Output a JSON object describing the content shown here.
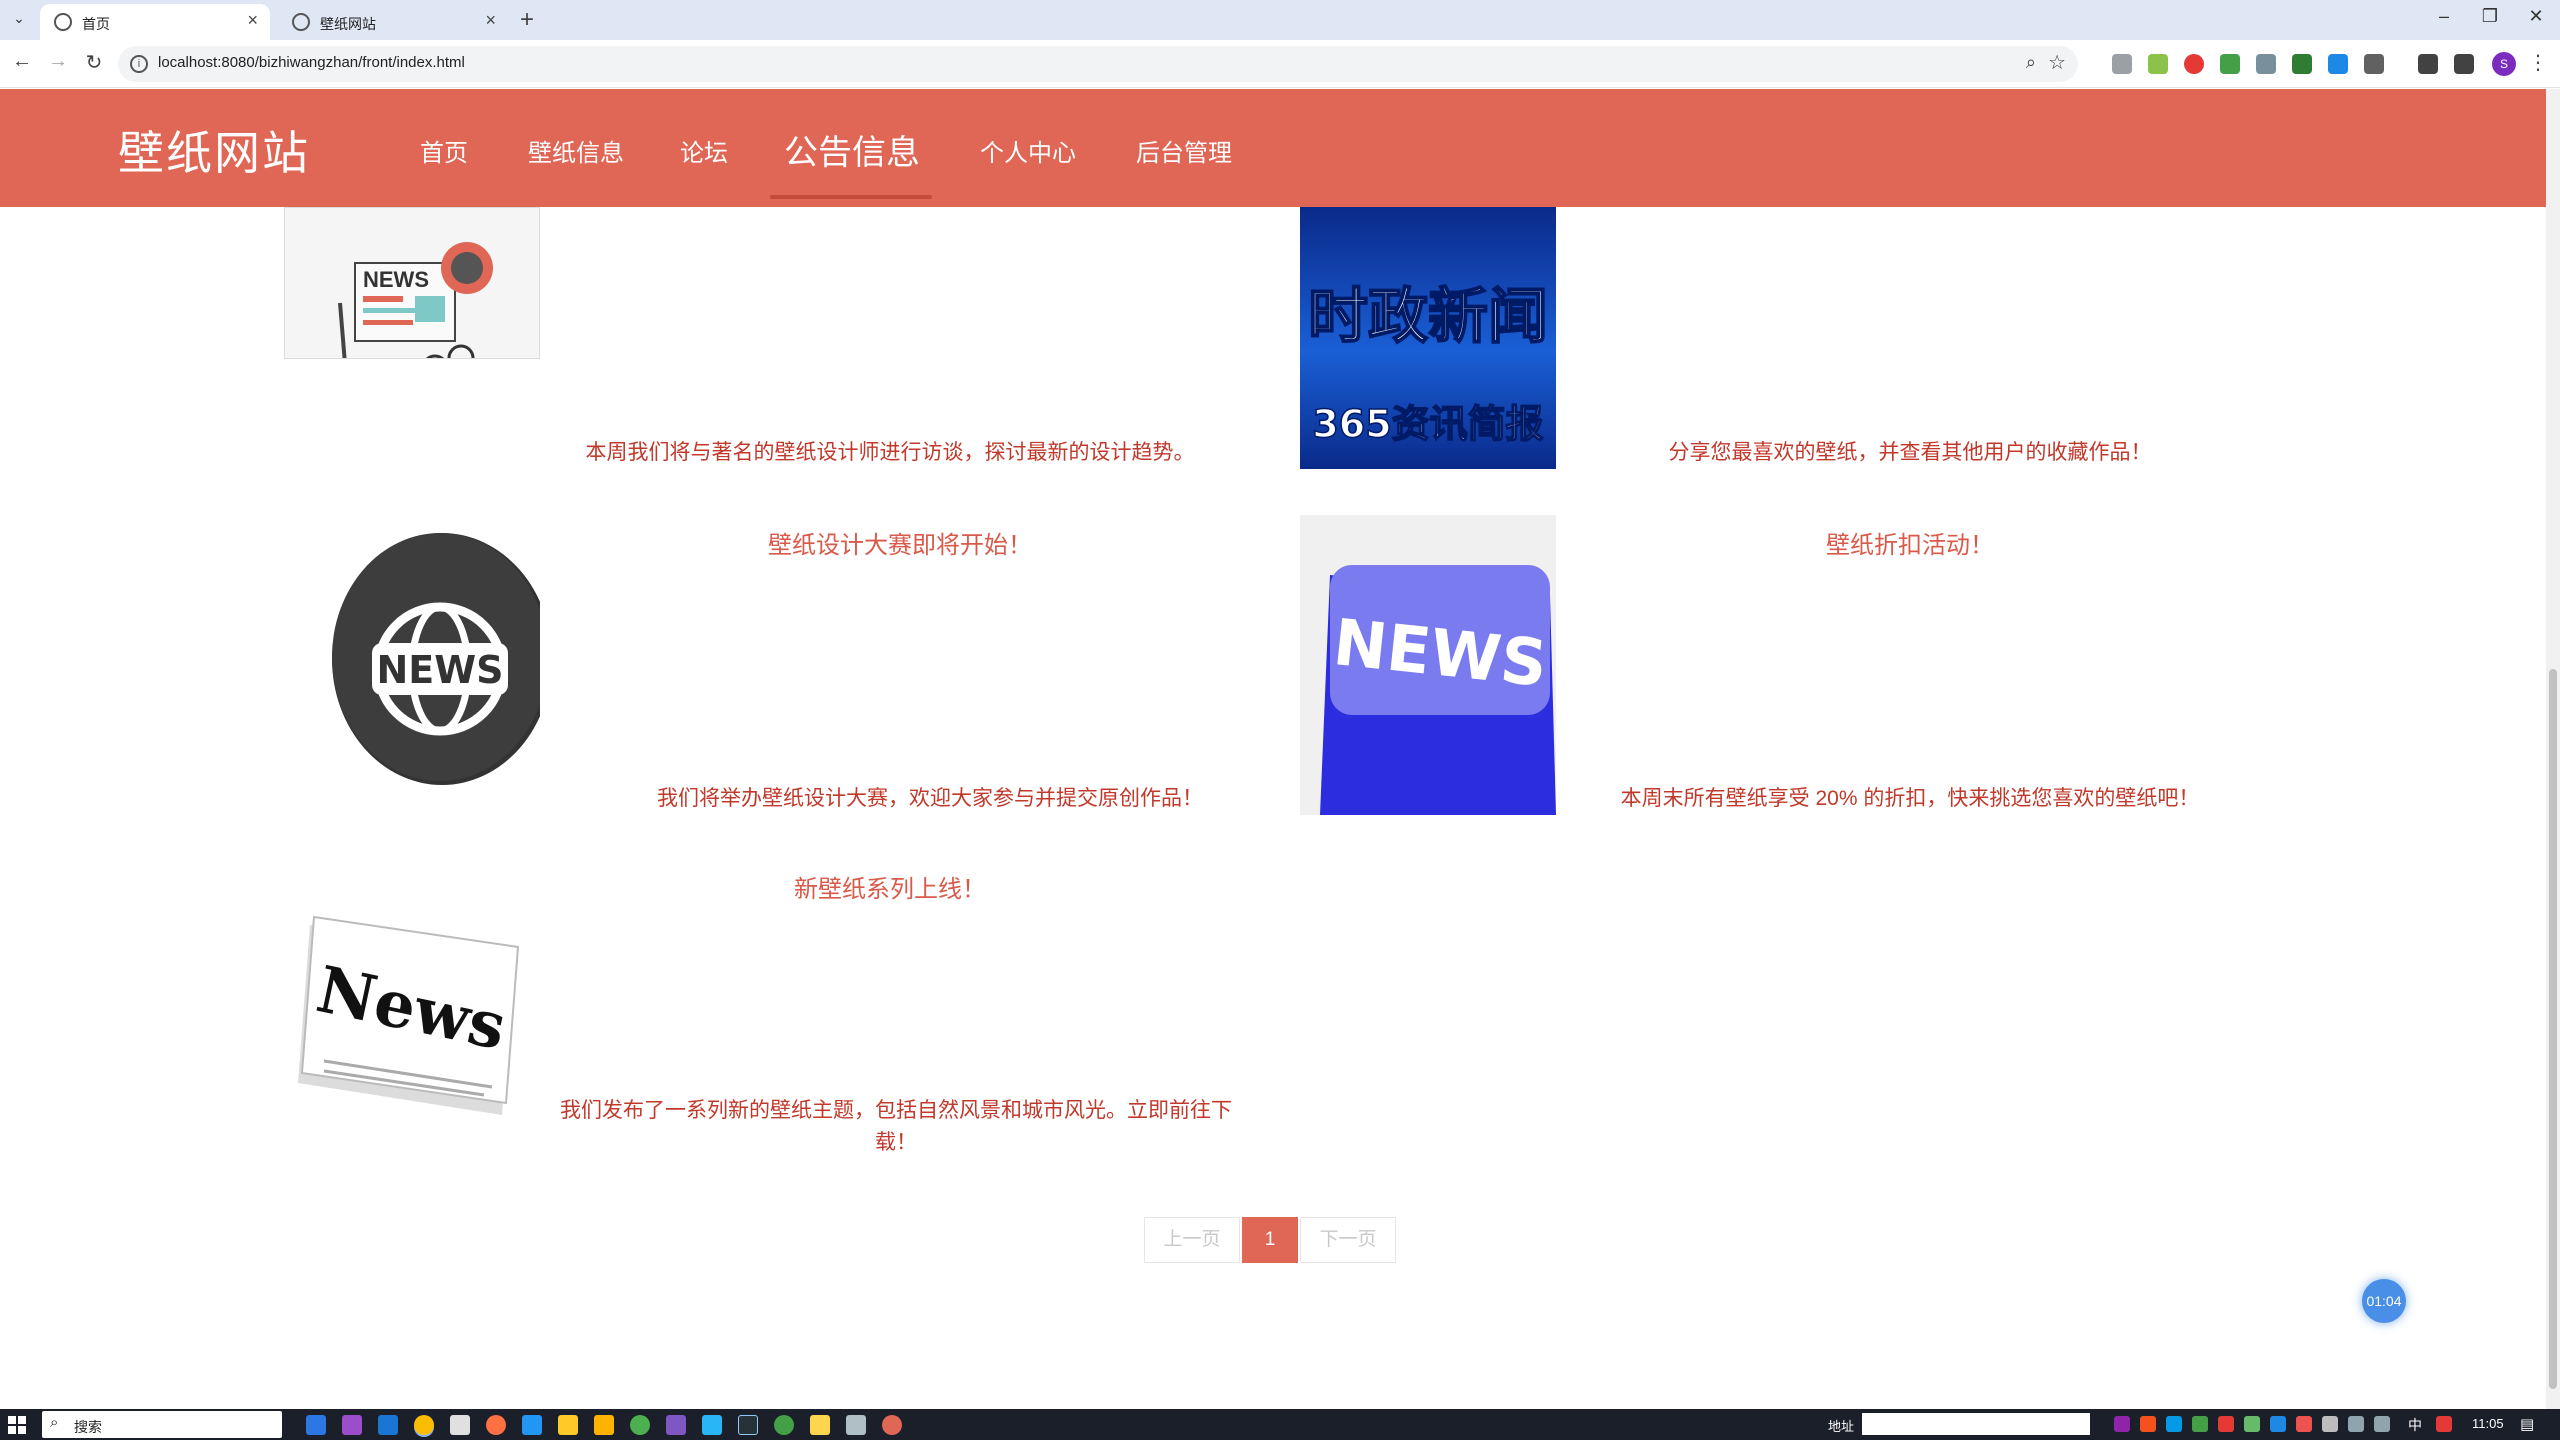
{
  "browser": {
    "tabs": [
      {
        "title": "首页",
        "active": true
      },
      {
        "title": "壁纸网站",
        "active": false
      }
    ],
    "url": "localhost:8080/bizhiwangzhan/front/index.html",
    "profile_initial": "S",
    "icons": {
      "back": "←",
      "forward": "→",
      "reload": "↻",
      "zoom": "⌕",
      "star": "☆",
      "close": "×",
      "new_tab": "+",
      "minimize": "–",
      "restore": "❐",
      "window_close": "✕",
      "tab_menu": "⌄",
      "menu": "⋮"
    }
  },
  "site": {
    "logo": "壁纸网站",
    "nav": [
      {
        "label": "首页",
        "active": false
      },
      {
        "label": "壁纸信息",
        "active": false
      },
      {
        "label": "论坛",
        "active": false
      },
      {
        "label": "公告信息",
        "active": true
      },
      {
        "label": "个人中心",
        "active": false
      },
      {
        "label": "后台管理",
        "active": false
      }
    ]
  },
  "news": [
    {
      "title": "",
      "summary": "本周我们将与著名的壁纸设计师进行访谈，探讨最新的设计趋势。",
      "image": "news-newspaper-illustration"
    },
    {
      "title": "",
      "summary": "分享您最喜欢的壁纸，并查看其他用户的收藏作品！",
      "image": "current-affairs-news-banner",
      "image_text_top": "时政新闻",
      "image_text_bottom": "365资讯简报"
    },
    {
      "title": "壁纸设计大赛即将开始！",
      "summary": "我们将举办壁纸设计大赛，欢迎大家参与并提交原创作品！",
      "image": "news-globe-icon",
      "image_text": "NEWS"
    },
    {
      "title": "壁纸折扣活动！",
      "summary": "本周末所有壁纸享受 20% 的折扣，快来挑选您喜欢的壁纸吧！",
      "image": "news-keyboard-key",
      "image_text": "NEWS"
    },
    {
      "title": "新壁纸系列上线！",
      "summary": "我们发布了一系列新的壁纸主题，包括自然风景和城市风光。立即前往下载！",
      "image": "news-paper-stack",
      "image_text": "News"
    }
  ],
  "pagination": {
    "prev": "上一页",
    "current": "1",
    "next": "下一页"
  },
  "timer": "01:04",
  "taskbar": {
    "search_placeholder": "搜索",
    "search_icon": "⌕",
    "address_label": "地址",
    "ime": "中",
    "clock": "11:05",
    "notify_icon": "▤"
  },
  "colors": {
    "header": "#e06655",
    "accent_text": "#c0392b",
    "title_text": "#d95a4a",
    "pager_active": "#e06655",
    "timer": "#4a8fe7"
  }
}
